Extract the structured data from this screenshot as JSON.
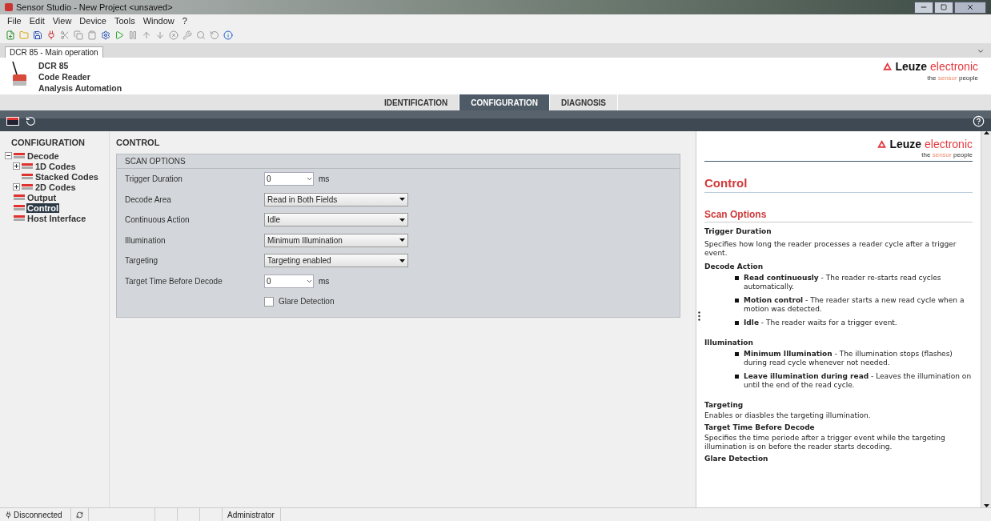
{
  "window": {
    "title": "Sensor Studio - New Project  <unsaved>"
  },
  "menu": [
    "File",
    "Edit",
    "View",
    "Device",
    "Tools",
    "Window",
    "?"
  ],
  "document_tab": {
    "label": "DCR 85 - Main operation",
    "selected": true
  },
  "device": {
    "name": "DCR 85",
    "type": "Code Reader",
    "category": "Analysis Automation"
  },
  "brand": {
    "name": "Leuze",
    "suffix": "electronic",
    "tagline_before": "the",
    "tagline_highlight": "sensor",
    "tagline_after": "people"
  },
  "help_brand": {
    "name": "Leuze",
    "suffix": "electronic",
    "tagline_before": "the",
    "tagline_highlight": "sensor",
    "tagline_after": "people"
  },
  "tabs": [
    {
      "label": "IDENTIFICATION",
      "selected": false
    },
    {
      "label": "CONFIGURATION",
      "selected": true
    },
    {
      "label": "DIAGNOSIS",
      "selected": false
    }
  ],
  "sidebar": {
    "title": "CONFIGURATION",
    "items": [
      {
        "label": "Decode",
        "expanded": true,
        "selected": false,
        "children": [
          {
            "label": "1D Codes",
            "expanded": false,
            "selected": false
          },
          {
            "label": "Stacked Codes",
            "selected": false
          },
          {
            "label": "2D Codes",
            "expanded": false,
            "selected": false
          }
        ]
      },
      {
        "label": "Output",
        "selected": false
      },
      {
        "label": "Control",
        "selected": true
      },
      {
        "label": "Host Interface",
        "selected": false
      }
    ]
  },
  "content": {
    "title": "CONTROL",
    "group": "SCAN OPTIONS",
    "fields": [
      {
        "kind": "spin",
        "label": "Trigger Duration",
        "value": "0",
        "unit": "ms"
      },
      {
        "kind": "select",
        "label": "Decode Area",
        "value": "Read in Both Fields"
      },
      {
        "kind": "select",
        "label": "Continuous Action",
        "value": "Idle"
      },
      {
        "kind": "select",
        "label": "Illumination",
        "value": "Minimum Illumination"
      },
      {
        "kind": "select",
        "label": "Targeting",
        "value": "Targeting enabled"
      },
      {
        "kind": "spin",
        "label": "Target Time Before Decode",
        "value": "0",
        "unit": "ms"
      },
      {
        "kind": "checkbox",
        "label": "Glare Detection",
        "checked": false
      }
    ]
  },
  "help": {
    "title": "Control",
    "section": "Scan Options",
    "blocks": [
      {
        "kind": "heading",
        "text": "Trigger Duration"
      },
      {
        "kind": "paragraph",
        "text": "Specifies how long the reader processes a reader cycle after a trigger event."
      },
      {
        "kind": "heading",
        "text": "Decode Action"
      },
      {
        "kind": "bullets",
        "items": [
          "**Read continuously** - The reader re-starts read cycles automatically.",
          "**Motion control** - The reader starts a new read cycle when a motion was detected.",
          "**Idle** - The reader waits for a trigger event."
        ]
      },
      {
        "kind": "heading",
        "text": "Illumination"
      },
      {
        "kind": "bullets",
        "items": [
          "**Minimum Illumination** - The illumination stops (flashes) during read cycle whenever not needed.",
          "**Leave illumination during read** - Leaves the illumination on until the end of the read cycle."
        ]
      },
      {
        "kind": "heading",
        "text": "Targeting"
      },
      {
        "kind": "tight",
        "text": "Enables or diasbles the targeting illumination."
      },
      {
        "kind": "heading",
        "text": "Target Time Before Decode"
      },
      {
        "kind": "tight",
        "text": "Specifies the time periode after a trigger event while the targeting illumination is on before the reader starts decoding."
      },
      {
        "kind": "heading",
        "text": "Glare Detection"
      }
    ]
  },
  "status_bar": {
    "connection": "Disconnected",
    "user": "Administrator"
  }
}
